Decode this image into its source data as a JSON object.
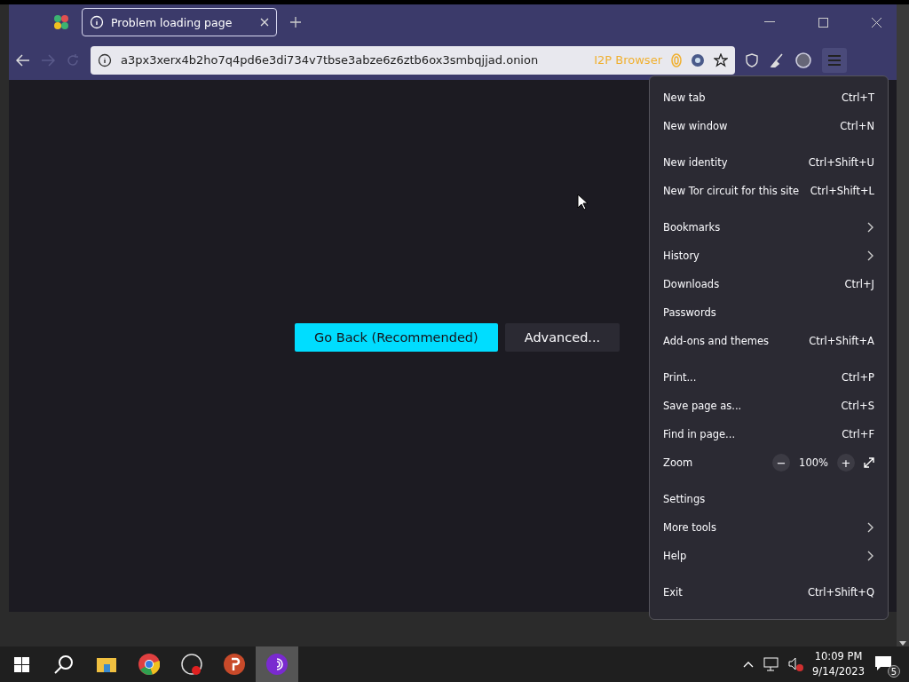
{
  "tab": {
    "title": "Problem loading page",
    "selected": true
  },
  "address": {
    "url": "a3px3xerx4b2ho7q4pd6e3di734v7tbse3abze6z6ztb6ox3smbqjjad.onion",
    "badge": "I2P Browser"
  },
  "buttons": [
    {
      "label": "Go Back (Recommended)",
      "kind": "primary"
    },
    {
      "label": "Advanced...",
      "kind": "secondary"
    }
  ],
  "menu_groups": [
    [
      {
        "label": "New tab",
        "kind": "shortcut",
        "shortcut": "Ctrl+T"
      },
      {
        "label": "New window",
        "kind": "shortcut",
        "shortcut": "Ctrl+N"
      }
    ],
    [
      {
        "label": "New identity",
        "kind": "shortcut",
        "shortcut": "Ctrl+Shift+U"
      },
      {
        "label": "New Tor circuit for this site",
        "kind": "shortcut",
        "shortcut": "Ctrl+Shift+L"
      }
    ],
    [
      {
        "label": "Bookmarks",
        "kind": "submenu"
      },
      {
        "label": "History",
        "kind": "submenu"
      },
      {
        "label": "Downloads",
        "kind": "shortcut",
        "shortcut": "Ctrl+J"
      },
      {
        "label": "Passwords",
        "kind": "shortcut"
      },
      {
        "label": "Add-ons and themes",
        "kind": "shortcut",
        "shortcut": "Ctrl+Shift+A"
      }
    ],
    [
      {
        "label": "Print...",
        "kind": "shortcut",
        "shortcut": "Ctrl+P"
      },
      {
        "label": "Save page as...",
        "kind": "shortcut",
        "shortcut": "Ctrl+S"
      },
      {
        "label": "Find in page...",
        "kind": "shortcut",
        "shortcut": "Ctrl+F"
      },
      {
        "label": "Zoom",
        "kind": "zoom",
        "minus": "−",
        "value": "100%",
        "plus": "+"
      }
    ],
    [
      {
        "label": "Settings",
        "kind": "shortcut"
      },
      {
        "label": "More tools",
        "kind": "submenu"
      },
      {
        "label": "Help",
        "kind": "submenu"
      }
    ],
    [
      {
        "label": "Exit",
        "kind": "shortcut",
        "shortcut": "Ctrl+Shift+Q"
      }
    ]
  ],
  "clock": {
    "time": "10:09 PM",
    "date": "9/14/2023"
  },
  "notifications": {
    "count": "5"
  }
}
